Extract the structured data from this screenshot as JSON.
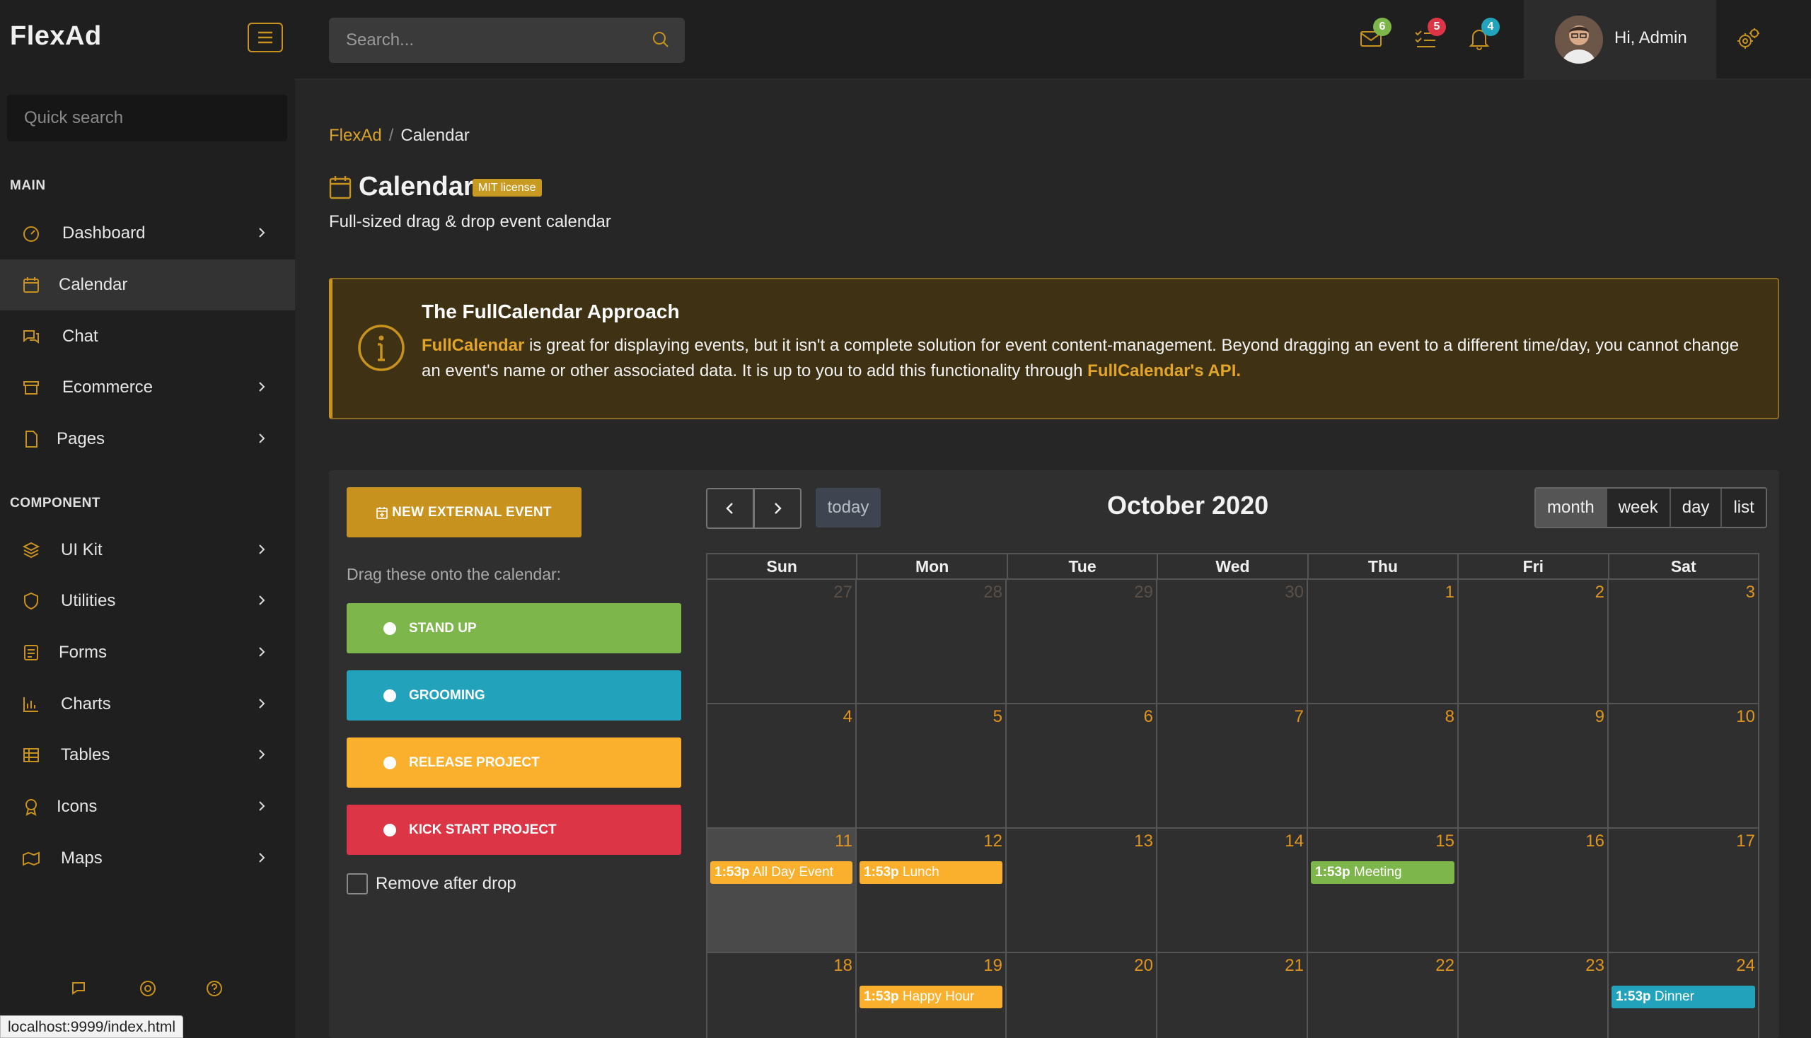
{
  "sidebar": {
    "brand": "FlexAd",
    "quick_search_placeholder": "Quick search",
    "main_label": "MAIN",
    "component_label": "COMPONENT",
    "items": [
      {
        "label": "Dashboard",
        "icon": "gauge-icon"
      },
      {
        "label": "Calendar",
        "icon": "calendar-icon"
      },
      {
        "label": "Chat",
        "icon": "chat-icon"
      },
      {
        "label": "Ecommerce",
        "icon": "store-icon"
      },
      {
        "label": "Pages",
        "icon": "file-icon"
      },
      {
        "label": "UI Kit",
        "icon": "layers-icon"
      },
      {
        "label": "Utilities",
        "icon": "shield-icon"
      },
      {
        "label": "Forms",
        "icon": "form-icon"
      },
      {
        "label": "Charts",
        "icon": "bar-chart-icon"
      },
      {
        "label": "Tables",
        "icon": "table-icon"
      },
      {
        "label": "Icons",
        "icon": "award-icon"
      },
      {
        "label": "Maps",
        "icon": "map-icon"
      }
    ],
    "status_url": "localhost:9999/index.html"
  },
  "topbar": {
    "search_placeholder": "Search...",
    "mail_count": "6",
    "tasks_count": "5",
    "notifications_count": "4",
    "user_greeting": "Hi, Admin"
  },
  "breadcrumb": {
    "root": "FlexAd",
    "separator": "/",
    "current": "Calendar"
  },
  "page": {
    "title": "Calendar",
    "license": "MIT license",
    "subtitle": "Full-sized drag & drop event calendar"
  },
  "alert": {
    "title": "The FullCalendar Approach",
    "link1": "FullCalendar",
    "text1": " is great for displaying events, but it isn't a complete solution for event content-management. Beyond dragging an event to a different time/day, you cannot change an event's name or other associated data. It is up to you to add this functionality through ",
    "link2": "FullCalendar's API."
  },
  "external": {
    "new_button": "NEW EXTERNAL EVENT",
    "hint": "Drag these onto the calendar:",
    "events": [
      {
        "label": "STAND UP",
        "color": "#7db64a"
      },
      {
        "label": "GROOMING",
        "color": "#22a3bb"
      },
      {
        "label": "RELEASE PROJECT",
        "color": "#fbb02d"
      },
      {
        "label": "KICK START PROJECT",
        "color": "#dc3545"
      }
    ],
    "remove_label": "Remove after drop"
  },
  "calendar": {
    "title": "October 2020",
    "today_label": "today",
    "views": [
      "month",
      "week",
      "day",
      "list"
    ],
    "active_view": "month",
    "weekdays": [
      "Sun",
      "Mon",
      "Tue",
      "Wed",
      "Thu",
      "Fri",
      "Sat"
    ],
    "weeks": [
      [
        "27",
        "28",
        "29",
        "30",
        "1",
        "2",
        "3"
      ],
      [
        "4",
        "5",
        "6",
        "7",
        "8",
        "9",
        "10"
      ],
      [
        "11",
        "12",
        "13",
        "14",
        "15",
        "16",
        "17"
      ],
      [
        "18",
        "19",
        "20",
        "21",
        "22",
        "23",
        "24"
      ]
    ],
    "other_month_days": [
      "27",
      "28",
      "29",
      "30"
    ],
    "today_date": "11",
    "events": [
      {
        "date": "11",
        "time": "1:53p",
        "title": "All Day Event",
        "color": "#fbb02d"
      },
      {
        "date": "12",
        "time": "1:53p",
        "title": "Lunch",
        "color": "#fbb02d"
      },
      {
        "date": "15",
        "time": "1:53p",
        "title": "Meeting",
        "color": "#7db64a"
      },
      {
        "date": "19",
        "time": "1:53p",
        "title": "Happy Hour",
        "color": "#fbb02d"
      },
      {
        "date": "24",
        "time": "1:53p",
        "title": "Dinner",
        "color": "#22a3bb"
      }
    ]
  },
  "colors": {
    "accent": "#c8921f",
    "badge_green": "#7db64a",
    "badge_red": "#dc3545",
    "badge_cyan": "#22a3bb"
  }
}
